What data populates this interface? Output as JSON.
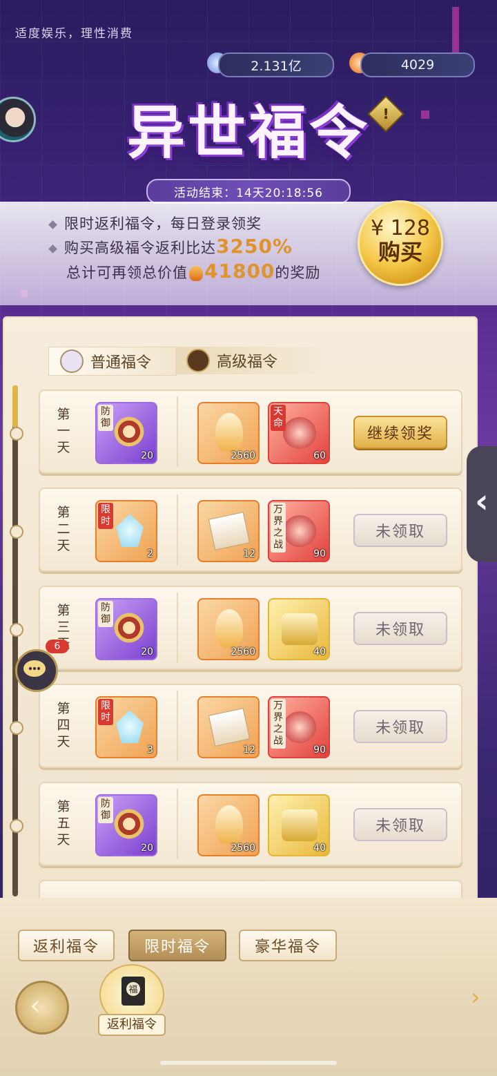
{
  "header": {
    "notice": "适度娱乐，理性消费",
    "resource_1": "2.131亿",
    "resource_2": "4029",
    "title": "异世福令",
    "timer": "活动结束：14天20:18:56"
  },
  "promo": {
    "line1": "限时返利福令，每日登录领奖",
    "line2_prefix": "购买高级福令返利比达",
    "line2_value": "3250%",
    "line3_prefix": "总计可再领总价值",
    "line3_value": "41800",
    "line3_suffix": "的奖励",
    "buy_price": "¥ 128",
    "buy_label": "购买"
  },
  "tabs": {
    "normal": "普通福令",
    "high": "高级福令"
  },
  "rows": [
    {
      "day": "第一天",
      "free": {
        "tag": "防御",
        "qty": "20"
      },
      "adv1": {
        "qty": "2560"
      },
      "adv2": {
        "tag": "天命",
        "qty": "60"
      },
      "button": "继续领奖"
    },
    {
      "day": "第二天",
      "free": {
        "tag": "限时",
        "qty": "2"
      },
      "adv1": {
        "qty": "12"
      },
      "adv2": {
        "tag": "万界之战",
        "qty": "90"
      },
      "button": "未领取"
    },
    {
      "day": "第三天",
      "free": {
        "tag": "防御",
        "qty": "20"
      },
      "adv1": {
        "qty": "2560"
      },
      "adv2": {
        "qty": "40"
      },
      "button": "未领取"
    },
    {
      "day": "第四天",
      "free": {
        "tag": "限时",
        "qty": "3"
      },
      "adv1": {
        "qty": "12"
      },
      "adv2": {
        "tag": "万界之战",
        "qty": "90"
      },
      "button": "未领取"
    },
    {
      "day": "第五天",
      "free": {
        "tag": "防御",
        "qty": "20"
      },
      "adv1": {
        "qty": "2560"
      },
      "adv2": {
        "qty": "40"
      },
      "button": "未领取"
    }
  ],
  "chat_badge": "6",
  "bottom_tabs": [
    "返利福令",
    "限时福令",
    "豪华福令"
  ],
  "bottom_selected": "限时福令",
  "feature_label": "返利福令",
  "feature_icon_text": "福",
  "colors": {
    "accent": "#e0932a",
    "tab_active": "#b38e56"
  }
}
